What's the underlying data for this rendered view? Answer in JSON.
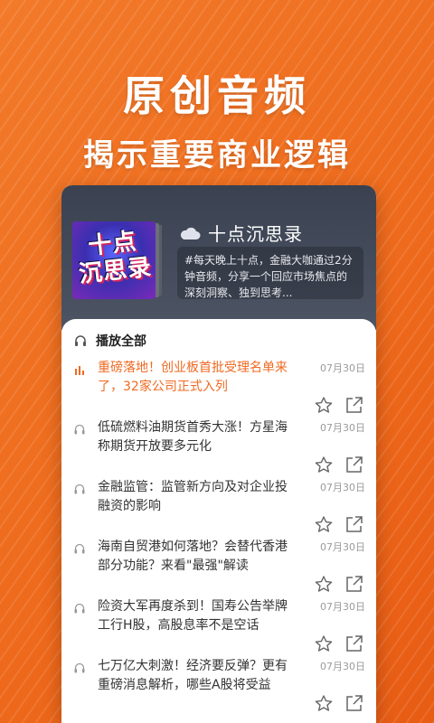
{
  "hero": {
    "title": "原创音频",
    "subtitle": "揭示重要商业逻辑"
  },
  "program": {
    "cover_text_line1": "十点",
    "cover_text_line2": "沉思录",
    "name": "十点沉思录",
    "description": "#每天晚上十点，金融大咖通过2分钟音频，分享一个回应市场焦点的深刻洞察、独到思考..."
  },
  "list": {
    "play_all_label": "播放全部",
    "items": [
      {
        "title": "重磅落地！创业板首批受理名单来了，32家公司正式入列",
        "date": "07月30日",
        "active": true
      },
      {
        "title": "低硫燃料油期货首秀大涨！方星海称期货开放要多元化",
        "date": "07月30日",
        "active": false
      },
      {
        "title": "金融监管：监管新方向及对企业投融资的影响",
        "date": "07月30日",
        "active": false
      },
      {
        "title": "海南自贸港如何落地？会替代香港部分功能？来看\"最强\"解读",
        "date": "07月30日",
        "active": false
      },
      {
        "title": "险资大军再度杀到！国寿公告举牌工行H股，高股息率不是空话",
        "date": "07月30日",
        "active": false
      },
      {
        "title": "七万亿大刺激！经济要反弹？更有重磅消息解析，哪些A股将受益",
        "date": "07月30日",
        "active": false
      }
    ]
  },
  "colors": {
    "accent": "#ef6a22",
    "background": "#ee6a1c",
    "header": "#3f4655"
  },
  "icons": {
    "cloud": "cloud-icon",
    "headphone": "headphone-icon",
    "playing": "equalizer-icon",
    "favorite": "star-icon",
    "share": "share-icon"
  }
}
